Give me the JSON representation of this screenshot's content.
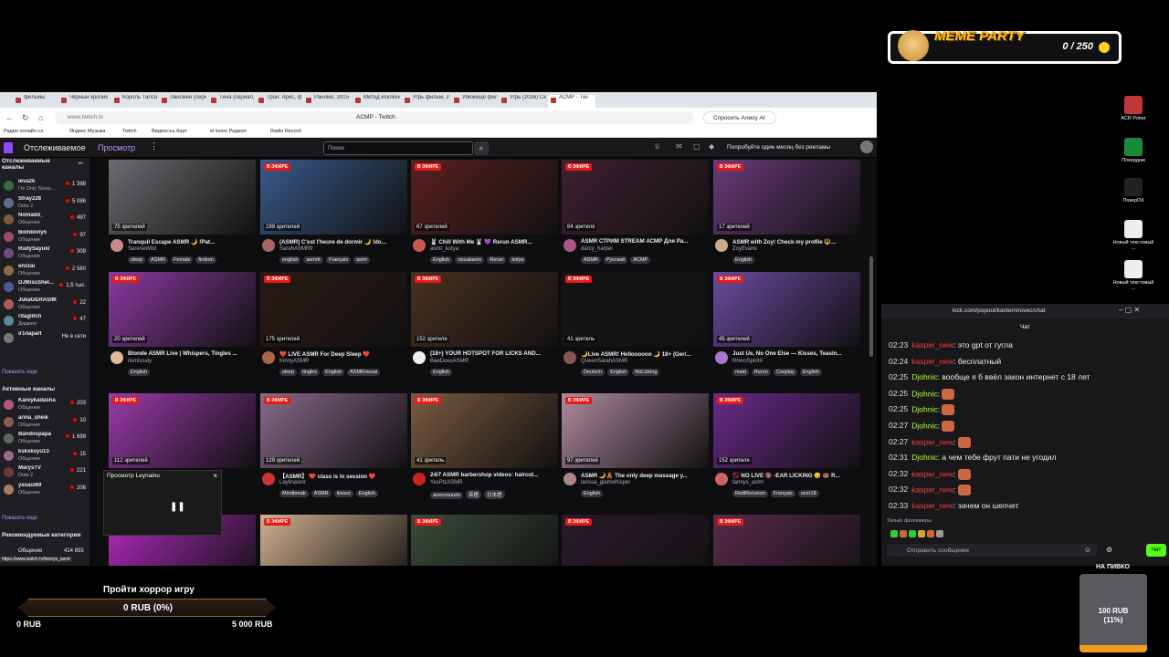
{
  "meme": {
    "title": "MEME PARTY",
    "counter": "0 / 250"
  },
  "browser": {
    "tabs": [
      "фильмы",
      "Чёрный кролик",
      "Король Талса (",
      "Лансмен (сери",
      "Тина (сериал, Т",
      "Трон: Арес, фиc",
      "Ранимо, 2015 —",
      "Метод исключе",
      "Угрь фильм, 20",
      "Убежище фили",
      "Угрь (2026) Смо",
      "АСМР - Тwi"
    ],
    "url": "www.twitch.tv",
    "page_title": "ACMP - Twitch",
    "alice": "Спросить Алису AI",
    "bookmarks": [
      "Радио онлайн сл",
      "Яндекс Музыка",
      "Twitch",
      "Видеосъъ Карт",
      "el loooo Радиол",
      "Radio Record"
    ],
    "nav": {
      "following": "Отслеживаемое",
      "browse": "Просмотр",
      "search_placeholder": "Поиск",
      "promo": "Попробуйте один месяц без рекламы"
    },
    "sidebar": {
      "header": "Отслеживаемые каналы",
      "followed": [
        {
          "name": "ieva2k",
          "game": "I'm Only Sleep...",
          "viewers": "1 388",
          "color": "#3a6b3a"
        },
        {
          "name": "Stray228",
          "game": "Dota 2",
          "viewers": "5 086",
          "color": "#5b6c8a"
        },
        {
          "name": "Nomadd_",
          "game": "Общение",
          "viewers": "497",
          "color": "#7a5a3a"
        },
        {
          "name": "Bomboпу5",
          "game": "Общение",
          "viewers": "97",
          "color": "#9a4a6a"
        },
        {
          "name": "RudySayuki",
          "game": "Общение",
          "viewers": "309",
          "color": "#6a4a8a"
        },
        {
          "name": "enzzal",
          "game": "Общение",
          "viewers": "2 560",
          "color": "#8a6a4a"
        },
        {
          "name": "DJMissSheI...",
          "game": "Общение",
          "viewers": "1,5 тыс.",
          "color": "#4a5a9a"
        },
        {
          "name": "JuliaGERASIM",
          "game": "Общение",
          "viewers": "22",
          "color": "#aa5a5a"
        },
        {
          "name": "ritaglitch",
          "game": "Диджеи",
          "viewers": "47",
          "color": "#5a8a9a"
        },
        {
          "name": "ir1napart",
          "game": "",
          "viewers": "Не в сети",
          "color": "#777"
        }
      ],
      "show_more": "Показать еще",
      "active_header": "Активные каналы",
      "active": [
        {
          "name": "Kareykadasha",
          "game": "Общение",
          "viewers": "203",
          "color": "#b05a7a"
        },
        {
          "name": "arina_sheik",
          "game": "Общение",
          "viewers": "10",
          "color": "#8a5a4a"
        },
        {
          "name": "Bandospapa",
          "game": "Общение",
          "viewers": "1 699",
          "color": "#5a6a5a"
        },
        {
          "name": "ksksksyu13",
          "game": "Общение",
          "viewers": "15",
          "color": "#9a6a8a"
        },
        {
          "name": "MarysTV",
          "game": "Dota 2",
          "viewers": "221",
          "color": "#6a3a3a"
        },
        {
          "name": "yesaui69",
          "game": "Общение",
          "viewers": "206",
          "color": "#aa7a5a"
        }
      ],
      "show_more2": "Показать еще",
      "rec_header": "Рекомендуемые категории",
      "rec_item": "Общение",
      "rec_viewers": "414 855",
      "status_url": "https://www.twitch.tv/fannys_asmr"
    },
    "live_label": "В ЭФИРЕ",
    "cards": [
      {
        "viewers": "75 зрителей",
        "title": "Tranquil Escape ASMR 🌙 !Pat...",
        "name": "SareneWild",
        "tags": [
          "sleep",
          "ASMR",
          "Female",
          "findom"
        ],
        "bg": "#6b6b70",
        "c": "#c88"
      },
      {
        "viewers": "199 зрителей",
        "title": "(ASMR) C'est l'heure de dormir 🌙 !do...",
        "name": "SarahASMRfr",
        "tags": [
          "english",
          "asmrfr",
          "Français",
          "asmr"
        ],
        "bg": "#3a5a8a",
        "c": "#a66"
      },
      {
        "viewers": "67 зрителей",
        "title": "🐰 Chill With Me 🐰 💜 Rerun ASMR...",
        "name": "asmr_kotya",
        "tags": [
          "English",
          "visualasmr",
          "Rerun",
          "kotya"
        ],
        "bg": "#5a2020",
        "c": "#c55"
      },
      {
        "viewers": "84 зрителя",
        "title": "ASMR СТРИМ STREAM АСМР Для Ра...",
        "name": "darcy_harpel",
        "tags": [
          "ASMR",
          "Русский",
          "ACMP"
        ],
        "bg": "#402030",
        "c": "#a58"
      },
      {
        "viewers": "17 зрителей",
        "title": "ASMR with Zoy! Check my profile 🔱...",
        "name": "ZoyEvans",
        "tags": [
          "English"
        ],
        "bg": "#6a3a7a",
        "c": "#ca8"
      },
      {
        "viewers": "20 зрителей",
        "title": "Blonde ASMR Live | Whispers, Tingles ...",
        "name": "itsmissaly",
        "tags": [
          "English"
        ],
        "bg": "#8a3aa0",
        "c": "#db9"
      },
      {
        "viewers": "175 зрителей",
        "title": "❤️ LIVE ASMR For Deep Sleep ❤️",
        "name": "KinnyASMR",
        "tags": [
          "sleep",
          "tingles",
          "English",
          "ASMRvisual"
        ],
        "bg": "#2a1a14",
        "c": "#a64"
      },
      {
        "viewers": "152 зрителя",
        "title": "(18+) YOUR HOTSPOT FOR LICKS AND...",
        "name": "BaeDoesASMR",
        "tags": [
          "English"
        ],
        "bg": "#4a3020",
        "c": "#eee"
      },
      {
        "viewers": "41 зритель",
        "title": "🌙Live ASMR! Helloooooo 🌙 18+ (Ger/...",
        "name": "QueenSarahASMR",
        "tags": [
          "Deutsch",
          "English",
          "NoLicking"
        ],
        "bg": "#151515",
        "c": "#855"
      },
      {
        "viewers": "45 зрителей",
        "title": "Just Us, No One Else — Kisses, Teasin...",
        "name": "RhinoSpiritX",
        "tags": [
          "maid",
          "Rerun",
          "Cosplay",
          "English"
        ],
        "bg": "#6a4aa0",
        "c": "#a7c"
      },
      {
        "viewers": "112 зрителей",
        "title": "",
        "name": "",
        "tags": [],
        "bg": "#9a3aaa",
        "c": "#a5a"
      },
      {
        "viewers": "129 зрителей",
        "title": "【ASMR】 ❤️ class is in session ❤️",
        "name": "Laylinasmr",
        "tags": [
          "Mindbreak",
          "ASMR",
          "kisses",
          "English"
        ],
        "bg": "#8a6a8a",
        "c": "#c33"
      },
      {
        "viewers": "41 зритель",
        "title": "24/7 ASMR barbershop videos: haircut...",
        "name": "YesPlzASMR",
        "tags": [
          "asmrsounds",
          "英語",
          "日本語"
        ],
        "bg": "#7a5a40",
        "c": "#c22"
      },
      {
        "viewers": "97 зрителей",
        "title": "ASMR 🌙🧸 The only deep massage y...",
        "name": "larissa_glamwhisper",
        "tags": [
          "English"
        ],
        "bg": "#b08aa0",
        "c": "#a88"
      },
      {
        "viewers": "152 зрителя",
        "title": "🚫 NO LIVE 🔞 -EAR LICKING 😋 🍩 R...",
        "name": "fannys_asmr",
        "tags": [
          "RedlRelusion",
          "Français",
          "over18"
        ],
        "bg": "#6a2a8a",
        "c": "#c66"
      },
      {
        "viewers": "",
        "title": "",
        "name": "",
        "tags": [],
        "bg": "#b02ac0",
        "c": ""
      },
      {
        "viewers": "",
        "title": "",
        "name": "",
        "tags": [],
        "bg": "#d0b090",
        "c": ""
      },
      {
        "viewers": "",
        "title": "",
        "name": "",
        "tags": [],
        "bg": "#3a4a3a",
        "c": ""
      },
      {
        "viewers": "",
        "title": "",
        "name": "",
        "tags": [],
        "bg": "#2a1a2a",
        "c": ""
      },
      {
        "viewers": "",
        "title": "",
        "name": "",
        "tags": [],
        "bg": "#5a2a4a",
        "c": ""
      }
    ],
    "preview_label": "Просмотр Leynainu"
  },
  "desktop": [
    {
      "label": "ACR Poker",
      "color": "#c0383a"
    },
    {
      "label": "Покердом",
      "color": "#1a8a3a"
    },
    {
      "label": "ПокерОК",
      "color": "#222"
    },
    {
      "label": "Новый текстовый ...",
      "color": "#eee"
    },
    {
      "label": "Новый текстовый ...",
      "color": "#eee"
    }
  ],
  "chat": {
    "url": "kick.com/popout/kantemirovec/chat",
    "title": "Чат",
    "messages": [
      {
        "time": "02:23",
        "user": "kasper_new",
        "color": "#ff3b3b",
        "text": "это gpt от гугла"
      },
      {
        "time": "02:24",
        "user": "kasper_new",
        "color": "#ff3b3b",
        "text": "бесплатный"
      },
      {
        "time": "02:25",
        "user": "Djohnic",
        "color": "#b4ff3b",
        "text": "вообще я б ввёл закон интернет с 18 лет"
      },
      {
        "time": "02:25",
        "user": "Djohnic",
        "color": "#b4ff3b",
        "text": ""
      },
      {
        "time": "02:25",
        "user": "Djohnic",
        "color": "#b4ff3b",
        "text": ""
      },
      {
        "time": "02:27",
        "user": "Djohnic",
        "color": "#b4ff3b",
        "text": ""
      },
      {
        "time": "02:27",
        "user": "kasper_new",
        "color": "#ff3b3b",
        "text": ""
      },
      {
        "time": "02:31",
        "user": "Djohnic",
        "color": "#b4ff3b",
        "text": "а чем тебе фрут пати не угодил"
      },
      {
        "time": "02:32",
        "user": "kasper_new",
        "color": "#ff3b3b",
        "text": ""
      },
      {
        "time": "02:32",
        "user": "kasper_new",
        "color": "#ff3b3b",
        "text": ""
      },
      {
        "time": "02:33",
        "user": "kasper_new",
        "color": "#ff3b3b",
        "text": "зачем он шепчет"
      }
    ],
    "followers_only": "Только фолловеры",
    "input_placeholder": "Отправить сообщение",
    "send": "Чат"
  },
  "goal": {
    "title": "Пройти хоррор игру",
    "progress": "0 RUB (0%)",
    "min": "0 RUB",
    "max": "5 000 RUB",
    "fraction": 0
  },
  "beer": {
    "title": "НА ПИВКО",
    "amount": "100 RUB",
    "percent": "(11%)",
    "fraction": 0.11
  }
}
